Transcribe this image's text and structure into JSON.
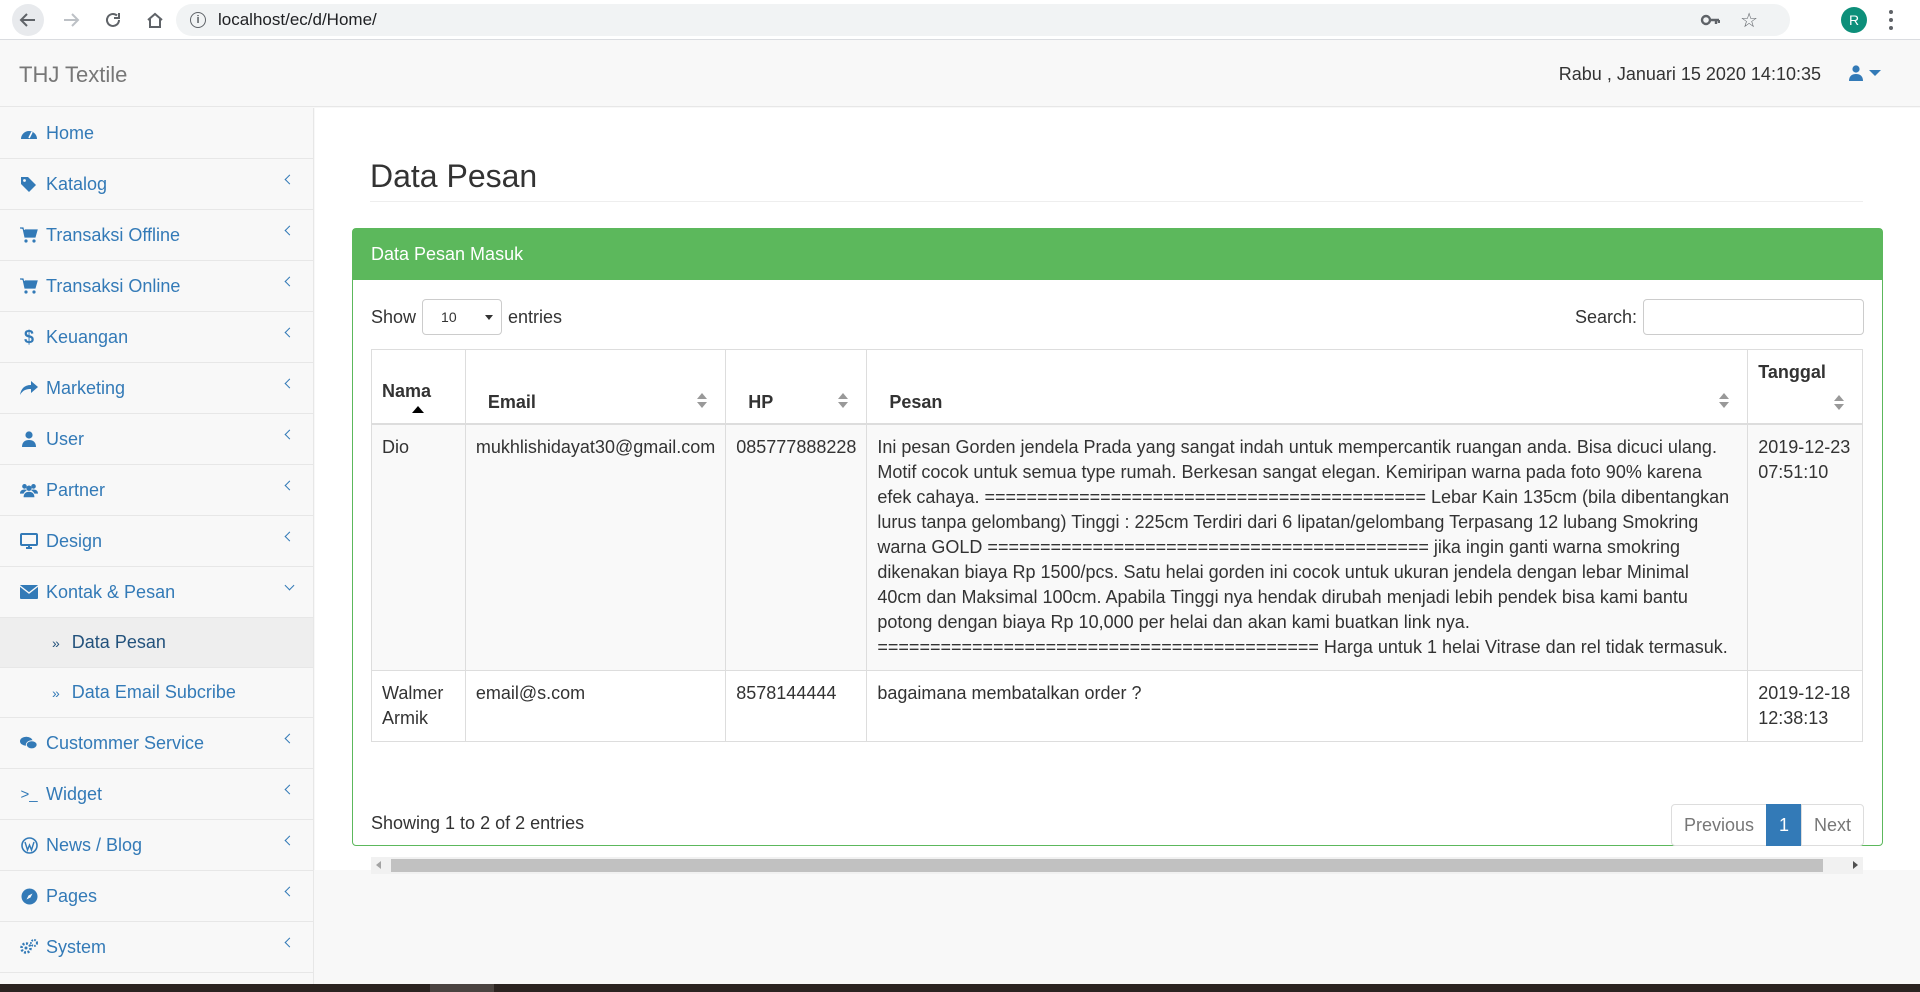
{
  "browser": {
    "url": "localhost/ec/d/Home/",
    "profile_initial": "R"
  },
  "header": {
    "brand": "THJ Textile",
    "datetime": "Rabu , Januari 15 2020 14:10:35"
  },
  "sidebar": {
    "items": [
      {
        "label": "Home",
        "icon": "dashboard-icon"
      },
      {
        "label": "Katalog",
        "icon": "tags-icon"
      },
      {
        "label": "Transaksi Offline",
        "icon": "cart-icon"
      },
      {
        "label": "Transaksi Online",
        "icon": "cart-icon"
      },
      {
        "label": "Keuangan",
        "icon": "dollar-icon"
      },
      {
        "label": "Marketing",
        "icon": "share-icon"
      },
      {
        "label": "User",
        "icon": "user-icon"
      },
      {
        "label": "Partner",
        "icon": "users-icon"
      },
      {
        "label": "Design",
        "icon": "desktop-icon"
      },
      {
        "label": "Kontak & Pesan",
        "icon": "envelope-icon"
      },
      {
        "label": "Customer Service",
        "icon": "chat-icon"
      },
      {
        "label": "Widget",
        "icon": "terminal-icon"
      },
      {
        "label": "News / Blog",
        "icon": "wordpress-icon"
      },
      {
        "label": "Pages",
        "icon": "compass-icon"
      },
      {
        "label": "System",
        "icon": "cogs-icon"
      }
    ],
    "subitems": [
      {
        "label": "Data Pesan"
      },
      {
        "label": "Data Email Subcribe"
      }
    ],
    "customer_service_label": "Custommer Service"
  },
  "main": {
    "title": "Data Pesan",
    "panel_title": "Data Pesan Masuk",
    "show_label": "Show",
    "entries_label": "entries",
    "page_length": "10",
    "search_label": "Search:",
    "search_value": "",
    "columns": [
      "Nama",
      "Email",
      "HP",
      "Pesan",
      "Tanggal"
    ],
    "rows": [
      {
        "nama": "Dio",
        "email": "mukhlishidayat30@gmail.com",
        "hp": "085777888228",
        "pesan": "Ini pesan Gorden jendela Prada yang sangat indah untuk mempercantik ruangan anda. Bisa dicuci ulang. Motif cocok untuk semua type rumah. Berkesan sangat elegan. Kemiripan warna pada foto 90% karena efek cahaya. ========================================== Lebar Kain 135cm (bila dibentangkan lurus tanpa gelombang) Tinggi : 225cm Terdiri dari 6 lipatan/gelombang Terpasang 12 lubang Smokring warna GOLD ========================================== jika ingin ganti warna smokring dikenakan biaya Rp 1500/pcs. Satu helai gorden ini cocok untuk ukuran jendela dengan lebar Minimal 40cm dan Maksimal 100cm. Apabila Tinggi nya hendak dirubah menjadi lebih pendek bisa kami bantu potong dengan biaya Rp 10,000 per helai dan akan kami buatkan link nya. ========================================== Harga untuk 1 helai Vitrase dan rel tidak termasuk.",
        "tanggal": "2019-12-23 07:51:10"
      },
      {
        "nama": "Walmer Armik",
        "email": "email@s.com",
        "hp": "8578144444",
        "pesan": "bagaimana membatalkan order ?",
        "tanggal": "2019-12-18 12:38:13"
      }
    ],
    "info": "Showing 1 to 2 of 2 entries",
    "pagination": {
      "previous": "Previous",
      "current": "1",
      "next": "Next"
    }
  },
  "colors": {
    "panel_green": "#5cb85c",
    "link_blue": "#337ab7"
  }
}
